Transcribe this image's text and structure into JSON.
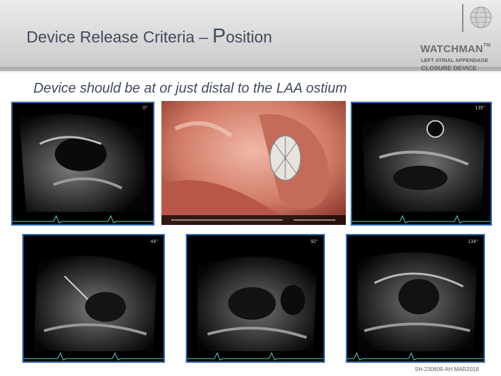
{
  "header": {
    "title_main": "Device Release Criteria – ",
    "title_initial": "P",
    "title_rest": "osition"
  },
  "brand": {
    "name": "WATCHMAN",
    "trademark": "TM",
    "tagline_line1": "LEFT ATRIAL APPENDAGE",
    "tagline_line2": "CLOSURE DEVICE"
  },
  "subtitle": "Device should be at or just distal to the LAA ostium",
  "images": {
    "echo_top_left_angle": "0°",
    "echo_top_right_angle": "135°",
    "echo_bottom_left_angle": "44°",
    "echo_bottom_middle_angle": "92°",
    "echo_bottom_right_angle": "134°"
  },
  "footer": {
    "code": "SH-230609-AH MAR2018"
  },
  "colors": {
    "title_text": "#3f4a5c",
    "frame_border": "#2f6cae",
    "brand_text": "#6a6e75"
  }
}
